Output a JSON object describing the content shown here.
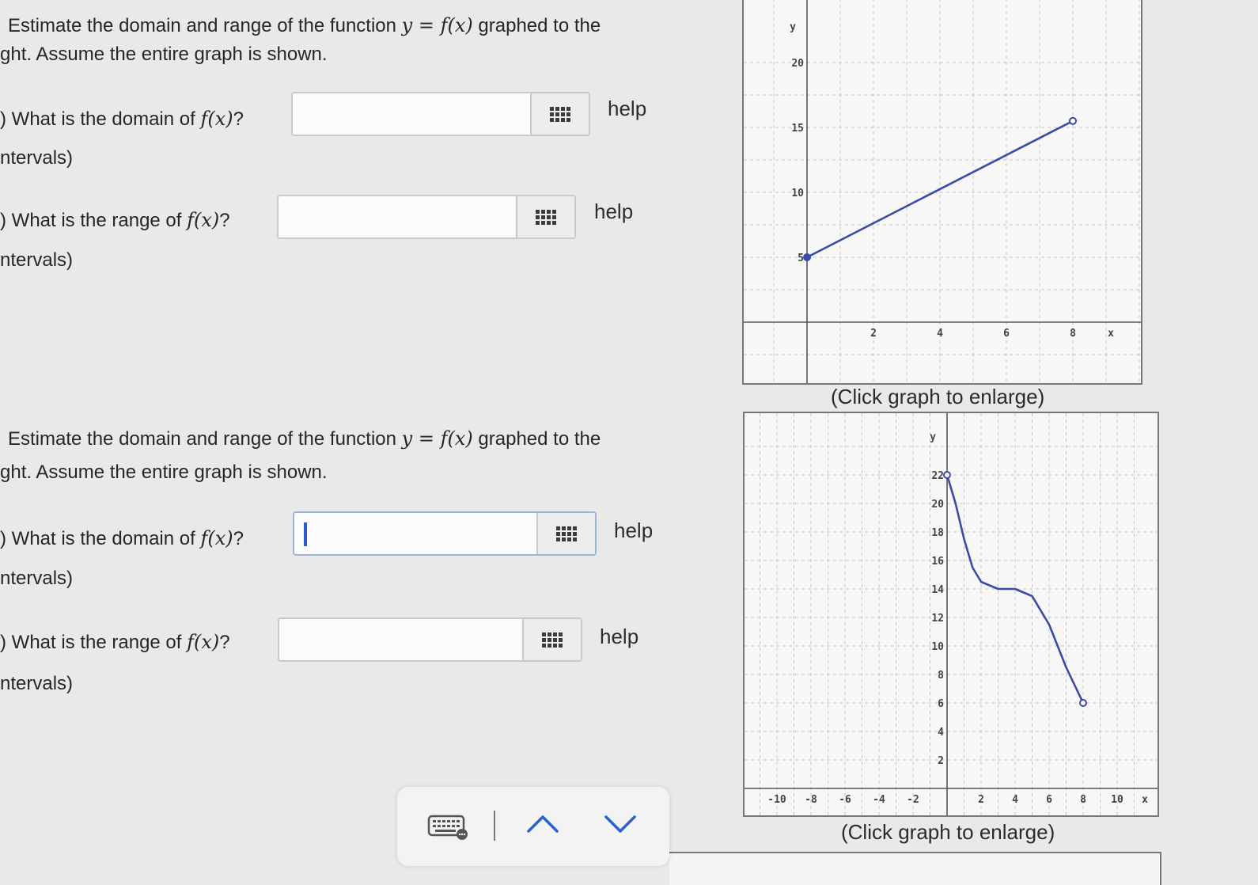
{
  "q1": {
    "prompt_line1_a": "Estimate the domain and range of the function",
    "prompt_line1_b": "graphed to the",
    "prompt_line2": "ght. Assume the entire graph is shown.",
    "part_a": {
      "label": ") What is the domain of",
      "suffix": "?",
      "note": "ntervals)",
      "help": "help"
    },
    "part_b": {
      "label": ") What is the range of",
      "suffix": "?",
      "note": "ntervals)",
      "help": "help"
    },
    "caption": "(Click graph to enlarge)"
  },
  "q2": {
    "prompt_line1_a": "Estimate the domain and range of the function",
    "prompt_line1_b": "graphed to the",
    "prompt_line2": "ght. Assume the entire graph is shown.",
    "part_a": {
      "label": ") What is the domain of",
      "suffix": "?",
      "note": "ntervals)",
      "help": "help"
    },
    "part_b": {
      "label": ") What is the range of",
      "suffix": "?",
      "note": "ntervals)",
      "help": "help"
    },
    "caption": "(Click graph to enlarge)"
  },
  "math": {
    "y_eq_fx": "y = f(x)",
    "fx": "f(x)"
  },
  "graph1": {
    "xlabel": "x",
    "ylabel": "y",
    "x_ticks": [
      "2",
      "4",
      "6",
      "8"
    ],
    "y_ticks": [
      "5",
      "10",
      "15",
      "20"
    ],
    "curve_color": "#3a4ba8"
  },
  "graph2": {
    "xlabel": "x",
    "ylabel": "y",
    "x_ticks": [
      "-10",
      "-8",
      "-6",
      "-4",
      "-2",
      "2",
      "4",
      "6",
      "8",
      "10"
    ],
    "y_ticks": [
      "2",
      "4",
      "6",
      "8",
      "10",
      "12",
      "14",
      "16",
      "18",
      "20",
      "22"
    ],
    "curve_color": "#3a4ba8"
  },
  "chart_data": [
    {
      "type": "line",
      "xlabel": "x",
      "ylabel": "y",
      "xlim": [
        -2,
        10
      ],
      "ylim": [
        -5,
        22
      ],
      "series": [
        {
          "x": [
            0,
            8
          ],
          "y": [
            5,
            15.5
          ],
          "start": "closed",
          "end": "open"
        }
      ]
    },
    {
      "type": "line",
      "xlabel": "x",
      "ylabel": "y",
      "xlim": [
        -11,
        11
      ],
      "ylim": [
        -4,
        24
      ],
      "series": [
        {
          "x": [
            0,
            0.5,
            1,
            1.5,
            2,
            3,
            3.5,
            4,
            5,
            6,
            7,
            8
          ],
          "y": [
            22,
            20,
            17.5,
            15.5,
            14.5,
            14,
            14,
            14,
            13.5,
            11.5,
            8.5,
            6
          ],
          "start": "open",
          "end": "open"
        }
      ]
    }
  ]
}
